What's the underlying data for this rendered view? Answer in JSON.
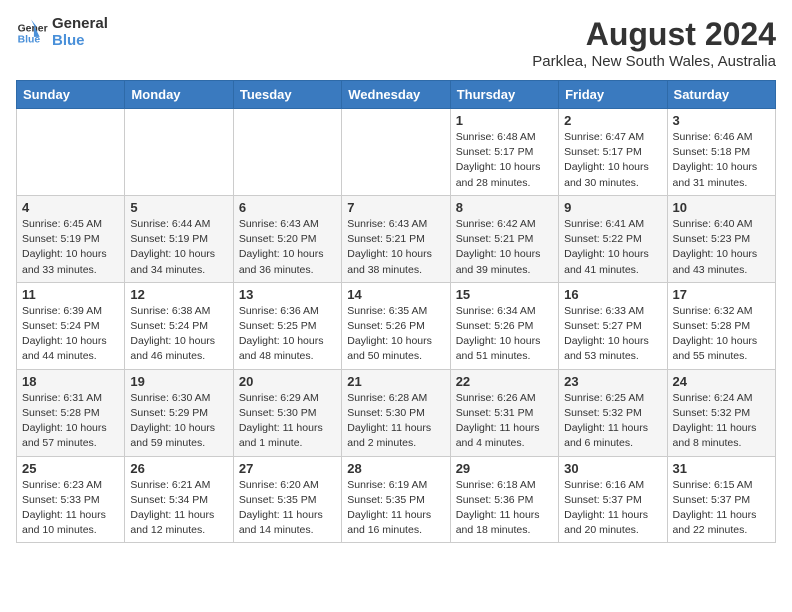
{
  "header": {
    "logo_line1": "General",
    "logo_line2": "Blue",
    "title": "August 2024",
    "subtitle": "Parklea, New South Wales, Australia"
  },
  "weekdays": [
    "Sunday",
    "Monday",
    "Tuesday",
    "Wednesday",
    "Thursday",
    "Friday",
    "Saturday"
  ],
  "weeks": [
    [
      {
        "day": "",
        "info": ""
      },
      {
        "day": "",
        "info": ""
      },
      {
        "day": "",
        "info": ""
      },
      {
        "day": "",
        "info": ""
      },
      {
        "day": "1",
        "info": "Sunrise: 6:48 AM\nSunset: 5:17 PM\nDaylight: 10 hours\nand 28 minutes."
      },
      {
        "day": "2",
        "info": "Sunrise: 6:47 AM\nSunset: 5:17 PM\nDaylight: 10 hours\nand 30 minutes."
      },
      {
        "day": "3",
        "info": "Sunrise: 6:46 AM\nSunset: 5:18 PM\nDaylight: 10 hours\nand 31 minutes."
      }
    ],
    [
      {
        "day": "4",
        "info": "Sunrise: 6:45 AM\nSunset: 5:19 PM\nDaylight: 10 hours\nand 33 minutes."
      },
      {
        "day": "5",
        "info": "Sunrise: 6:44 AM\nSunset: 5:19 PM\nDaylight: 10 hours\nand 34 minutes."
      },
      {
        "day": "6",
        "info": "Sunrise: 6:43 AM\nSunset: 5:20 PM\nDaylight: 10 hours\nand 36 minutes."
      },
      {
        "day": "7",
        "info": "Sunrise: 6:43 AM\nSunset: 5:21 PM\nDaylight: 10 hours\nand 38 minutes."
      },
      {
        "day": "8",
        "info": "Sunrise: 6:42 AM\nSunset: 5:21 PM\nDaylight: 10 hours\nand 39 minutes."
      },
      {
        "day": "9",
        "info": "Sunrise: 6:41 AM\nSunset: 5:22 PM\nDaylight: 10 hours\nand 41 minutes."
      },
      {
        "day": "10",
        "info": "Sunrise: 6:40 AM\nSunset: 5:23 PM\nDaylight: 10 hours\nand 43 minutes."
      }
    ],
    [
      {
        "day": "11",
        "info": "Sunrise: 6:39 AM\nSunset: 5:24 PM\nDaylight: 10 hours\nand 44 minutes."
      },
      {
        "day": "12",
        "info": "Sunrise: 6:38 AM\nSunset: 5:24 PM\nDaylight: 10 hours\nand 46 minutes."
      },
      {
        "day": "13",
        "info": "Sunrise: 6:36 AM\nSunset: 5:25 PM\nDaylight: 10 hours\nand 48 minutes."
      },
      {
        "day": "14",
        "info": "Sunrise: 6:35 AM\nSunset: 5:26 PM\nDaylight: 10 hours\nand 50 minutes."
      },
      {
        "day": "15",
        "info": "Sunrise: 6:34 AM\nSunset: 5:26 PM\nDaylight: 10 hours\nand 51 minutes."
      },
      {
        "day": "16",
        "info": "Sunrise: 6:33 AM\nSunset: 5:27 PM\nDaylight: 10 hours\nand 53 minutes."
      },
      {
        "day": "17",
        "info": "Sunrise: 6:32 AM\nSunset: 5:28 PM\nDaylight: 10 hours\nand 55 minutes."
      }
    ],
    [
      {
        "day": "18",
        "info": "Sunrise: 6:31 AM\nSunset: 5:28 PM\nDaylight: 10 hours\nand 57 minutes."
      },
      {
        "day": "19",
        "info": "Sunrise: 6:30 AM\nSunset: 5:29 PM\nDaylight: 10 hours\nand 59 minutes."
      },
      {
        "day": "20",
        "info": "Sunrise: 6:29 AM\nSunset: 5:30 PM\nDaylight: 11 hours\nand 1 minute."
      },
      {
        "day": "21",
        "info": "Sunrise: 6:28 AM\nSunset: 5:30 PM\nDaylight: 11 hours\nand 2 minutes."
      },
      {
        "day": "22",
        "info": "Sunrise: 6:26 AM\nSunset: 5:31 PM\nDaylight: 11 hours\nand 4 minutes."
      },
      {
        "day": "23",
        "info": "Sunrise: 6:25 AM\nSunset: 5:32 PM\nDaylight: 11 hours\nand 6 minutes."
      },
      {
        "day": "24",
        "info": "Sunrise: 6:24 AM\nSunset: 5:32 PM\nDaylight: 11 hours\nand 8 minutes."
      }
    ],
    [
      {
        "day": "25",
        "info": "Sunrise: 6:23 AM\nSunset: 5:33 PM\nDaylight: 11 hours\nand 10 minutes."
      },
      {
        "day": "26",
        "info": "Sunrise: 6:21 AM\nSunset: 5:34 PM\nDaylight: 11 hours\nand 12 minutes."
      },
      {
        "day": "27",
        "info": "Sunrise: 6:20 AM\nSunset: 5:35 PM\nDaylight: 11 hours\nand 14 minutes."
      },
      {
        "day": "28",
        "info": "Sunrise: 6:19 AM\nSunset: 5:35 PM\nDaylight: 11 hours\nand 16 minutes."
      },
      {
        "day": "29",
        "info": "Sunrise: 6:18 AM\nSunset: 5:36 PM\nDaylight: 11 hours\nand 18 minutes."
      },
      {
        "day": "30",
        "info": "Sunrise: 6:16 AM\nSunset: 5:37 PM\nDaylight: 11 hours\nand 20 minutes."
      },
      {
        "day": "31",
        "info": "Sunrise: 6:15 AM\nSunset: 5:37 PM\nDaylight: 11 hours\nand 22 minutes."
      }
    ]
  ]
}
